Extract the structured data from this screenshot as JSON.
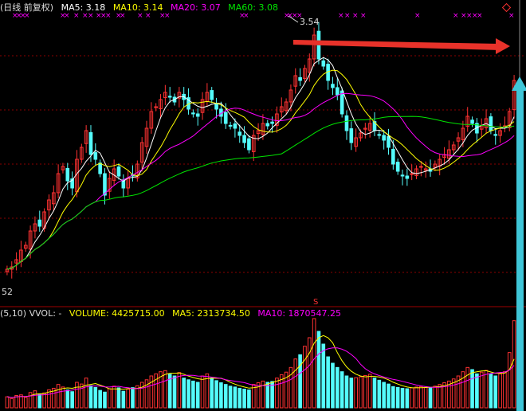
{
  "header": {
    "title": "(日线 前复权)",
    "ma5": "MA5: 3.18",
    "ma10": "MA10: 3.14",
    "ma20": "MA20: 3.07",
    "ma60": "MA60: 3.08"
  },
  "annotations": {
    "peak_label": "3.54",
    "low_label": "52"
  },
  "volume_header": {
    "prefix": "(5,10)  VVOL: -",
    "volume": "VOLUME: 4425715.00",
    "ma5": "MA5: 2313734.50",
    "ma10": "MA10: 1870547.25"
  },
  "colors": {
    "up": "#ff3232",
    "down": "#54fcfc",
    "ma5": "#ffffff",
    "ma10": "#ffff00",
    "ma20": "#ff00ff",
    "ma60": "#00e600",
    "grid": "#8b0000",
    "arrow_red": "#e8322a",
    "arrow_cyan": "#3fc6d8"
  },
  "chart_data": {
    "type": "candlestick",
    "title": "(日线 前复权)",
    "ylim": [
      2.52,
      3.62
    ],
    "series": [
      {
        "name": "MA5",
        "value": 3.18
      },
      {
        "name": "MA10",
        "value": 3.14
      },
      {
        "name": "MA20",
        "value": 3.07
      },
      {
        "name": "MA60",
        "value": 3.08
      }
    ],
    "close": [
      2.56,
      2.57,
      2.6,
      2.64,
      2.66,
      2.72,
      2.75,
      2.74,
      2.8,
      2.85,
      2.88,
      2.96,
      2.99,
      2.93,
      2.9,
      3.02,
      3.07,
      3.14,
      3.04,
      3.02,
      2.96,
      2.87,
      2.94,
      2.98,
      2.95,
      2.9,
      2.94,
      2.95,
      3.0,
      3.09,
      3.15,
      3.22,
      3.24,
      3.27,
      3.3,
      3.28,
      3.26,
      3.3,
      3.27,
      3.23,
      3.21,
      3.2,
      3.27,
      3.3,
      3.27,
      3.23,
      3.2,
      3.17,
      3.16,
      3.15,
      3.12,
      3.09,
      3.06,
      3.12,
      3.14,
      3.17,
      3.16,
      3.17,
      3.21,
      3.24,
      3.26,
      3.31,
      3.37,
      3.35,
      3.4,
      3.44,
      3.54,
      3.44,
      3.41,
      3.35,
      3.32,
      3.29,
      3.21,
      3.14,
      3.09,
      3.11,
      3.13,
      3.15,
      3.17,
      3.14,
      3.12,
      3.1,
      3.07,
      3.0,
      2.97,
      2.95,
      2.94,
      2.96,
      2.98,
      2.99,
      2.98,
      2.97,
      3.0,
      3.02,
      3.04,
      3.06,
      3.08,
      3.11,
      3.15,
      3.2,
      3.17,
      3.13,
      3.16,
      3.19,
      3.14,
      3.12,
      3.14,
      3.16,
      3.22,
      3.35
    ],
    "volume": [
      52,
      44,
      58,
      61,
      49,
      72,
      80,
      66,
      70,
      85,
      92,
      110,
      98,
      84,
      76,
      120,
      112,
      140,
      104,
      96,
      82,
      74,
      90,
      102,
      94,
      78,
      88,
      95,
      104,
      120,
      132,
      150,
      160,
      170,
      175,
      158,
      150,
      166,
      140,
      132,
      126,
      120,
      150,
      160,
      140,
      128,
      118,
      110,
      102,
      98,
      92,
      88,
      84,
      110,
      118,
      126,
      120,
      124,
      140,
      156,
      168,
      190,
      230,
      250,
      290,
      330,
      420,
      360,
      300,
      240,
      210,
      190,
      170,
      150,
      140,
      142,
      146,
      152,
      158,
      140,
      130,
      120,
      112,
      100,
      96,
      92,
      90,
      94,
      98,
      100,
      96,
      94,
      102,
      110,
      118,
      126,
      136,
      150,
      170,
      190,
      180,
      160,
      168,
      176,
      160,
      150,
      160,
      170,
      260,
      410
    ]
  }
}
